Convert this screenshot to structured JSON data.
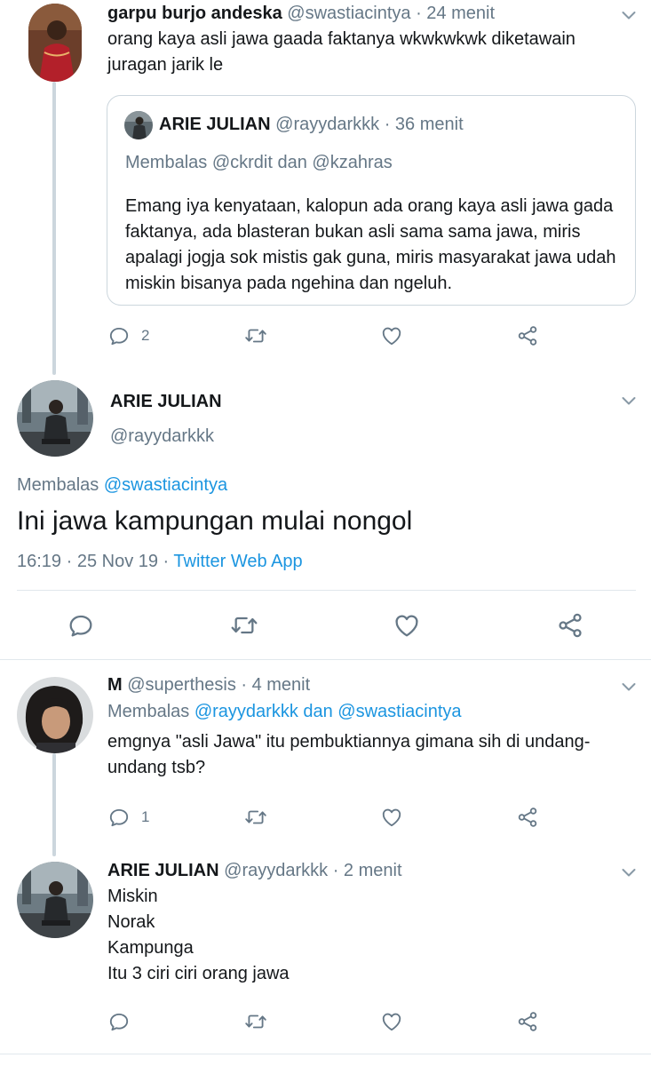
{
  "tweet1": {
    "name": "garpu burjo andeska",
    "handle": "@swastiacintya",
    "time": "· 24 menit",
    "text": "orang kaya asli jawa gaada faktanya wkwkwkwk diketawain juragan jarik le",
    "quote": {
      "name": "ARIE JULIAN",
      "handle": "@rayydarkkk",
      "time": "· 36 menit",
      "reply_prefix": "Membalas",
      "reply_to": "@ckrdit dan @kzahras",
      "text": "Emang iya kenyataan, kalopun ada orang kaya asli jawa gada faktanya, ada blasteran bukan asli sama sama jawa, miris apalagi jogja sok mistis gak guna, miris masyarakat jawa udah miskin bisanya pada ngehina dan ngeluh."
    },
    "reply_count": "2"
  },
  "main_tweet": {
    "name": "ARIE JULIAN",
    "handle": "@rayydarkkk",
    "reply_prefix": "Membalas",
    "reply_to": "@swastiacintya",
    "text": "Ini jawa kampungan mulai nongol",
    "meta_time": "16:19 · 25 Nov 19 ·",
    "meta_source": "Twitter Web App"
  },
  "tweet3": {
    "name": "M",
    "handle": "@superthesis",
    "time": "· 4 menit",
    "reply_prefix": "Membalas",
    "reply_to": "@rayydarkkk dan @swastiacintya",
    "text": "emgnya \"asli Jawa\" itu pembuktiannya gimana sih di undang-undang tsb?",
    "reply_count": "1"
  },
  "tweet4": {
    "name": "ARIE JULIAN",
    "handle": "@rayydarkkk",
    "time": "· 2 menit",
    "lines": [
      "Miskin",
      "Norak",
      "Kampunga",
      "Itu 3 ciri ciri orang jawa"
    ]
  },
  "icons": {
    "reply": "reply-bubble-icon",
    "retweet": "retweet-icon",
    "like": "heart-icon",
    "share": "share-icon",
    "menu": "chevron-down-icon"
  },
  "colors": {
    "text": "#14171a",
    "muted": "#657786",
    "link": "#1b95e0",
    "thread_line": "#ccd6dd",
    "divider": "#e1e8ed"
  }
}
